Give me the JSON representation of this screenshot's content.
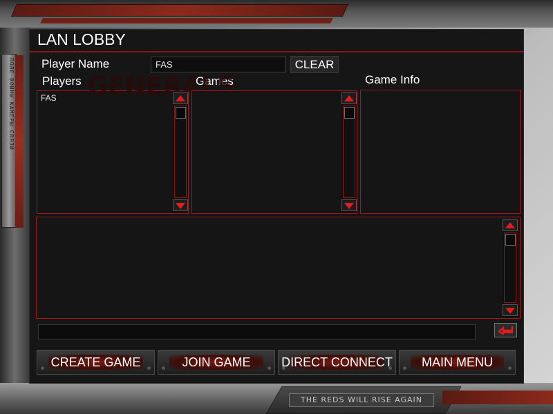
{
  "window": {
    "title": "LAN LOBBY"
  },
  "player_name": {
    "label": "Player Name",
    "value": "FAS",
    "clear_label": "CLEAR"
  },
  "players": {
    "header": "Players",
    "items": [
      "FAS"
    ]
  },
  "games": {
    "header": "Games",
    "items": []
  },
  "game_info": {
    "header": "Game Info"
  },
  "chat": {
    "input_value": ""
  },
  "buttons": {
    "create_game": "CREATE GAME",
    "join_game": "JOIN GAME",
    "direct_connect": "DIRECT CONNECT",
    "main_menu": "MAIN MENU"
  },
  "decor": {
    "side_text": "ПОЛЕ ВОЙНЫ КАМЕРЫ СВЯЗИ",
    "tagline": "THE REDS WILL RISE AGAIN",
    "logo_text": "GENERALS"
  },
  "colors": {
    "accent_red": "#a01818",
    "arrow_red": "#e21c1c",
    "panel_bg": "#151515"
  },
  "icons": {
    "scroll_up": "triangle-up-icon",
    "scroll_down": "triangle-down-icon",
    "send": "return-arrow-icon"
  }
}
